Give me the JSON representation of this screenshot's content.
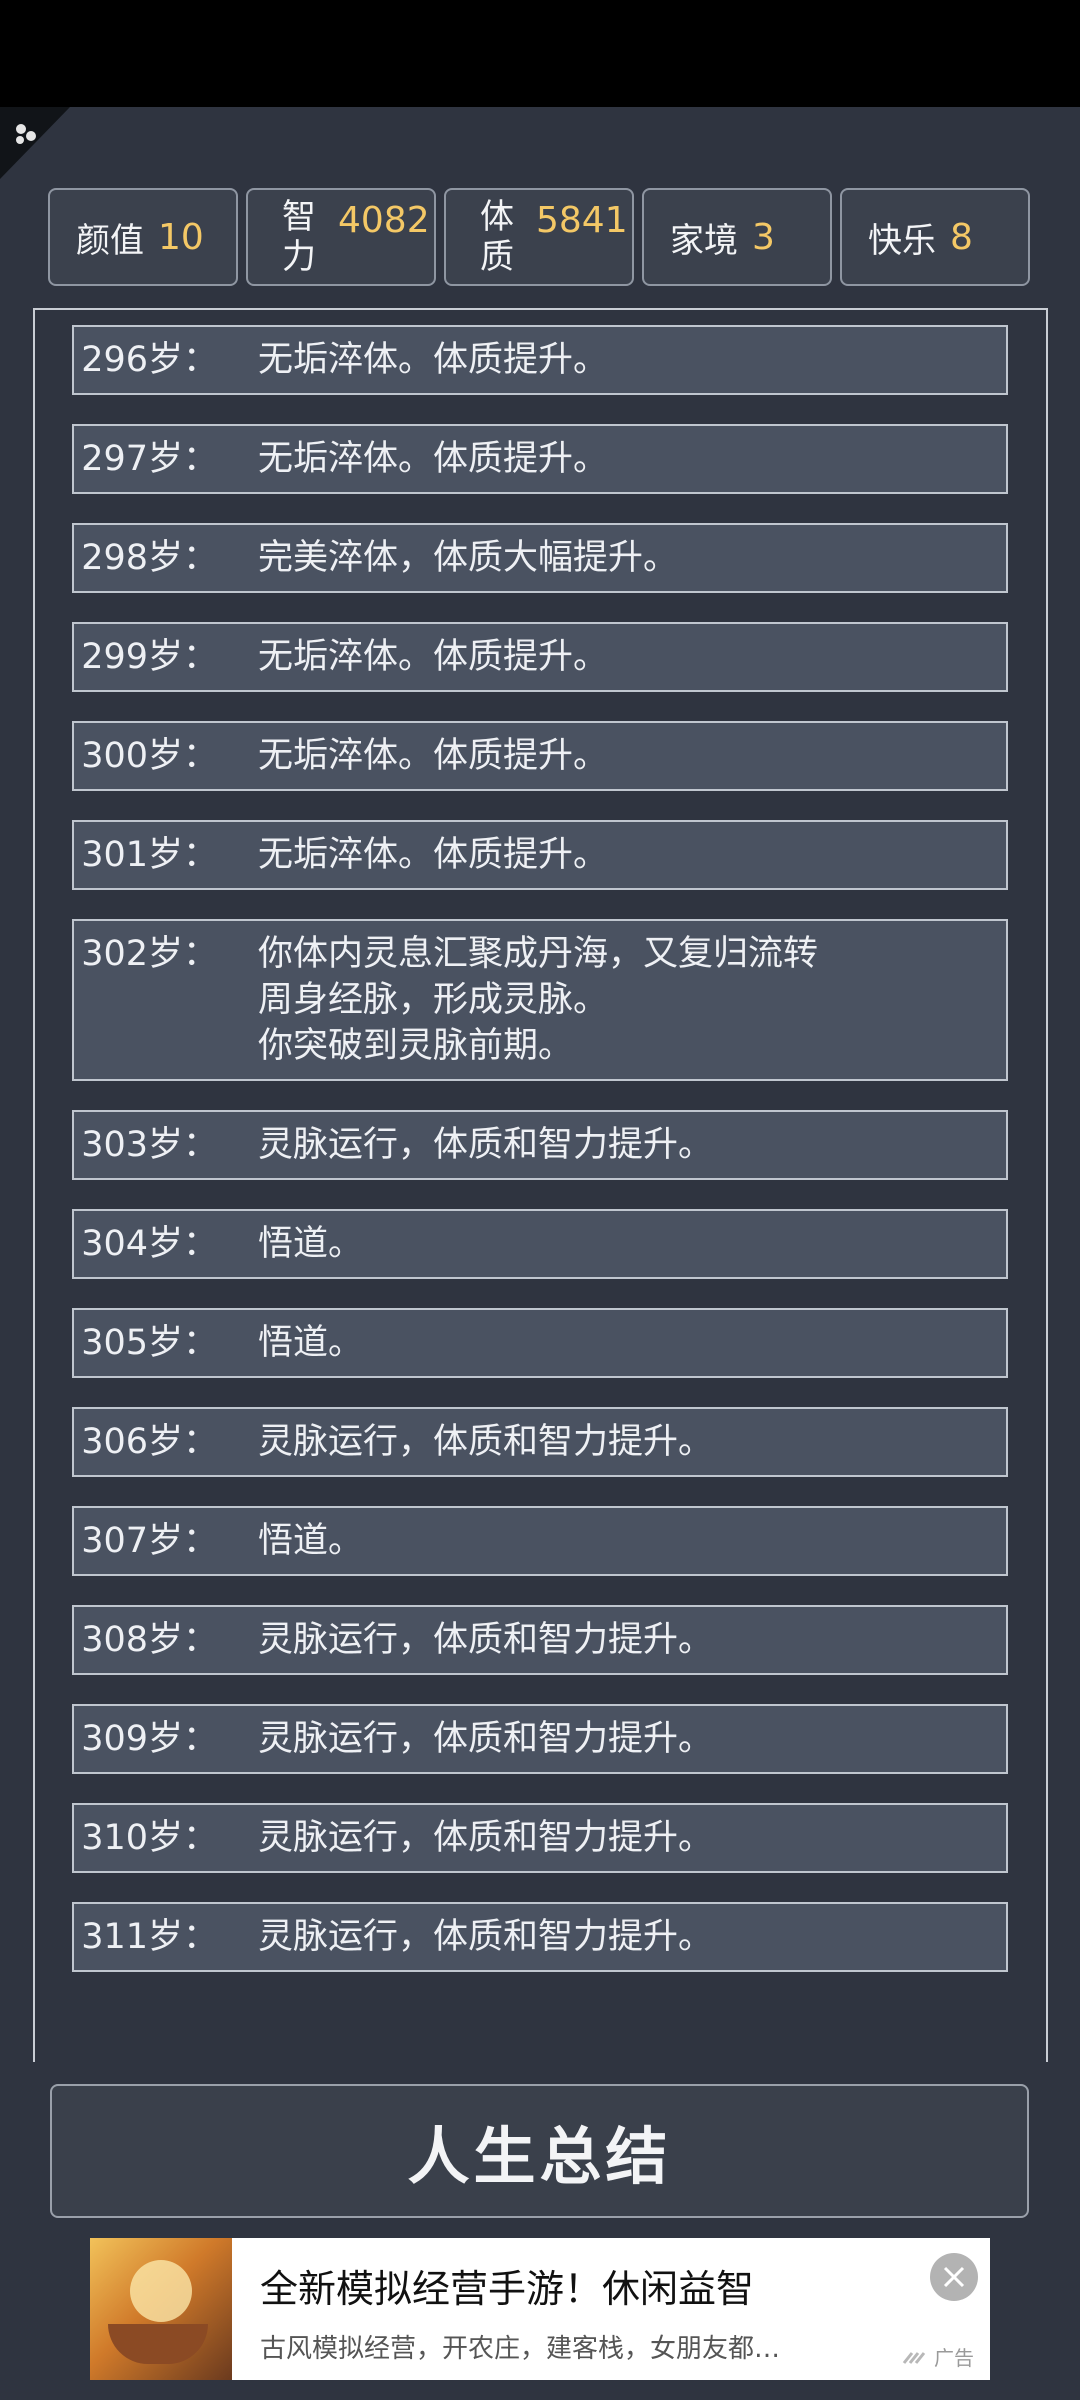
{
  "stats": [
    {
      "label": "颜值",
      "value": "10"
    },
    {
      "label": "智力",
      "value": "4082"
    },
    {
      "label": "体质",
      "value": "5841"
    },
    {
      "label": "家境",
      "value": "3"
    },
    {
      "label": "快乐",
      "value": "8"
    }
  ],
  "log": [
    {
      "age": "296岁：",
      "lines": [
        "无垢淬体。体质提升。"
      ]
    },
    {
      "age": "297岁：",
      "lines": [
        "无垢淬体。体质提升。"
      ]
    },
    {
      "age": "298岁：",
      "lines": [
        "完美淬体，体质大幅提升。"
      ]
    },
    {
      "age": "299岁：",
      "lines": [
        "无垢淬体。体质提升。"
      ]
    },
    {
      "age": "300岁：",
      "lines": [
        "无垢淬体。体质提升。"
      ]
    },
    {
      "age": "301岁：",
      "lines": [
        "无垢淬体。体质提升。"
      ]
    },
    {
      "age": "302岁：",
      "lines": [
        "你体内灵息汇聚成丹海，又复归流转",
        "周身经脉，形成灵脉。",
        "你突破到灵脉前期。"
      ]
    },
    {
      "age": "303岁：",
      "lines": [
        "灵脉运行，体质和智力提升。"
      ]
    },
    {
      "age": "304岁：",
      "lines": [
        "悟道。"
      ]
    },
    {
      "age": "305岁：",
      "lines": [
        "悟道。"
      ]
    },
    {
      "age": "306岁：",
      "lines": [
        "灵脉运行，体质和智力提升。"
      ]
    },
    {
      "age": "307岁：",
      "lines": [
        "悟道。"
      ]
    },
    {
      "age": "308岁：",
      "lines": [
        "灵脉运行，体质和智力提升。"
      ]
    },
    {
      "age": "309岁：",
      "lines": [
        "灵脉运行，体质和智力提升。"
      ]
    },
    {
      "age": "310岁：",
      "lines": [
        "灵脉运行，体质和智力提升。"
      ]
    },
    {
      "age": "311岁：",
      "lines": [
        "灵脉运行，体质和智力提升。"
      ]
    }
  ],
  "summary_button": "人生总结",
  "ad": {
    "title": "全新模拟经营手游！休闲益智",
    "description": "古风模拟经营，开农庄，建客栈，女朋友都…",
    "tag": "广告",
    "close_icon": "close-icon"
  }
}
